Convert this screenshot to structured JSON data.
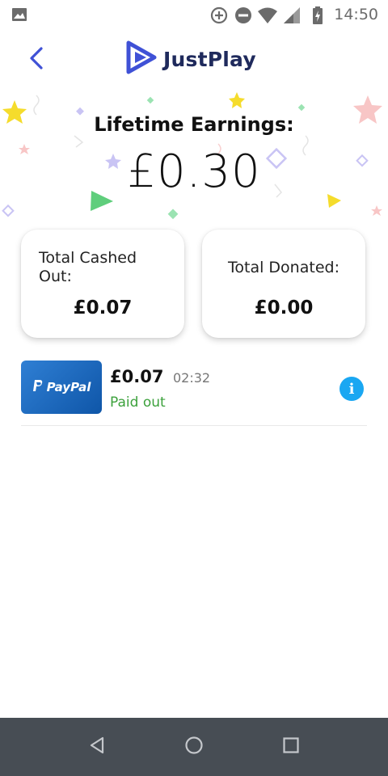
{
  "status_bar": {
    "time": "14:50",
    "icons": [
      "image-icon",
      "data-saver-icon",
      "do-not-disturb-icon",
      "wifi-icon",
      "signal-icon",
      "battery-icon"
    ]
  },
  "header": {
    "back_icon": "back-arrow-icon",
    "logo_icon": "justplay-logo-icon",
    "app_name": "JustPlay"
  },
  "earnings": {
    "title": "Lifetime Earnings:",
    "amount": "£0.30"
  },
  "cards": {
    "cashed_out": {
      "label": "Total Cashed Out:",
      "value": "£0.07"
    },
    "donated": {
      "label": "Total Donated:",
      "value": "£0.00"
    }
  },
  "transactions": [
    {
      "provider_label": "PayPal",
      "amount": "£0.07",
      "time": "02:32",
      "status": "Paid out",
      "info_icon": "info-icon"
    }
  ],
  "colors": {
    "accent_blue": "#3f51d6",
    "brand_navy": "#1f2a5c",
    "status_green": "#3ca13c",
    "info_blue": "#1aa7f2",
    "nav_bar": "#474d54"
  },
  "nav_bar": {
    "icons": [
      "nav-back-icon",
      "nav-home-icon",
      "nav-recents-icon"
    ]
  }
}
